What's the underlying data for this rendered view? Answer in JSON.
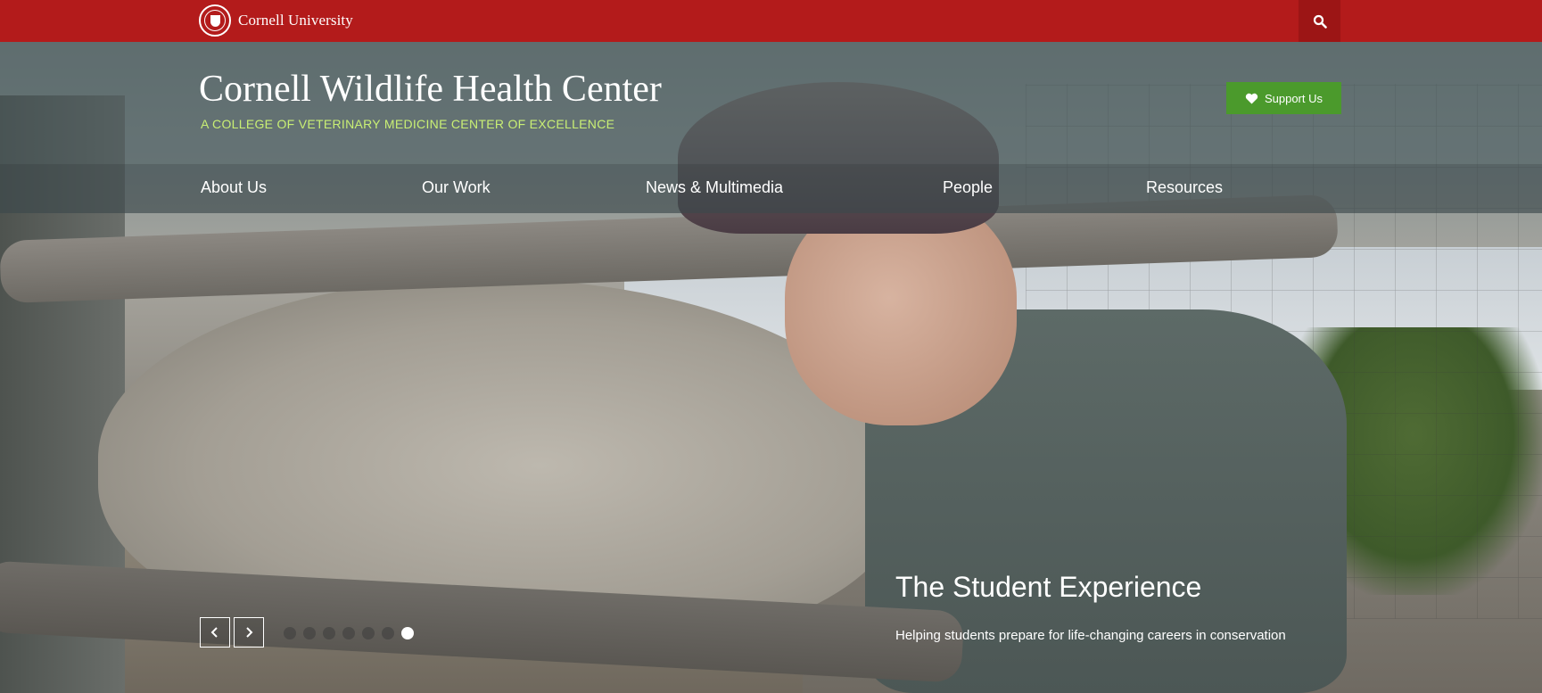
{
  "topbar": {
    "university_name": "Cornell University",
    "search_icon": "search-icon",
    "color": "#b31b1b"
  },
  "header": {
    "title": "Cornell Wildlife Health Center",
    "subtitle": "A COLLEGE OF VETERINARY MEDICINE CENTER OF EXCELLENCE",
    "support_label": "Support Us",
    "support_icon": "heart-icon",
    "subtitle_color": "#c9ef74",
    "support_color": "#4b9a2c"
  },
  "nav": {
    "items": [
      {
        "label": "About Us"
      },
      {
        "label": "Our Work"
      },
      {
        "label": "News & Multimedia"
      },
      {
        "label": "People"
      },
      {
        "label": "Resources"
      }
    ]
  },
  "slider": {
    "title": "The Student Experience",
    "description": "Helping students prepare for life-changing careers in conservation",
    "prev_icon": "chevron-left-icon",
    "next_icon": "chevron-right-icon",
    "dot_count": 7,
    "active_index": 6
  }
}
